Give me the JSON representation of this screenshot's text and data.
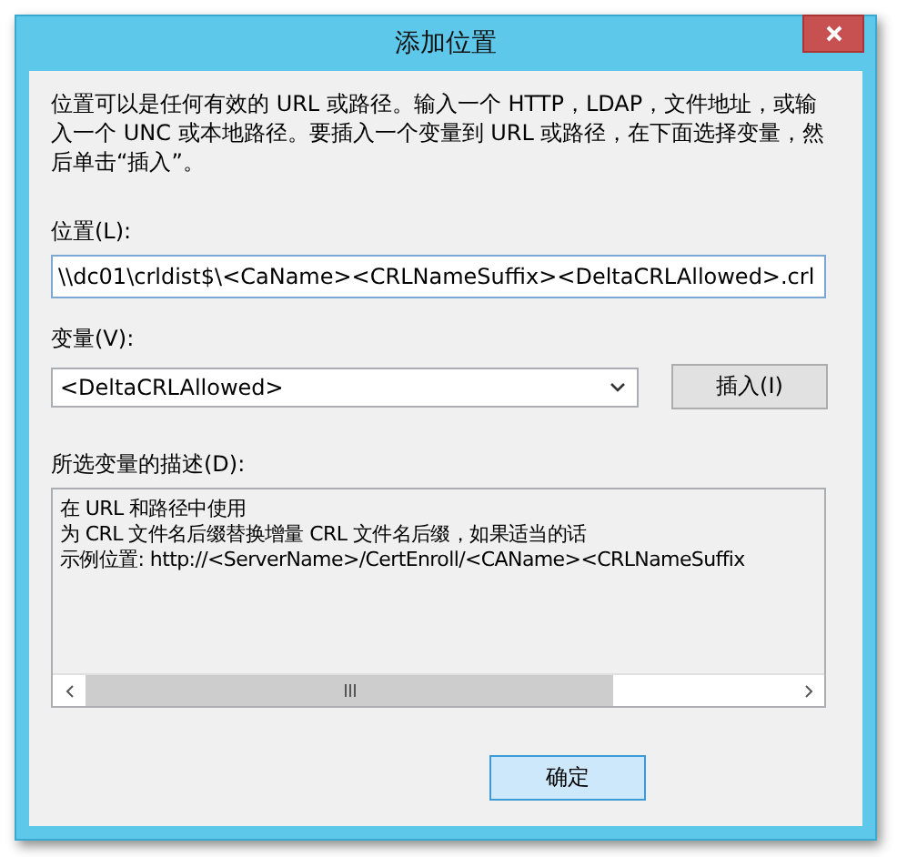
{
  "window": {
    "title": "添加位置"
  },
  "intro": "位置可以是任何有效的 URL 或路径。输入一个 HTTP，LDAP，文件地址，或输入一个 UNC 或本地路径。要插入一个变量到 URL 或路径，在下面选择变量，然后单击“插入”。",
  "location": {
    "label": "位置(L):",
    "value": "\\\\dc01\\crldist$\\<CaName><CRLNameSuffix><DeltaCRLAllowed>.crl"
  },
  "variable": {
    "label": "变量(V):",
    "value": "<DeltaCRLAllowed>"
  },
  "insert_button": "插入(I)",
  "description": {
    "label": "所选变量的描述(D):",
    "lines": [
      "在 URL 和路径中使用",
      "为 CRL 文件名后缀替换增量 CRL 文件名后缀，如果适当的话",
      "示例位置: http://<ServerName>/CertEnroll/<CAName><CRLNameSuffix"
    ]
  },
  "buttons": [
    {
      "label": "确定",
      "focused": true
    }
  ]
}
